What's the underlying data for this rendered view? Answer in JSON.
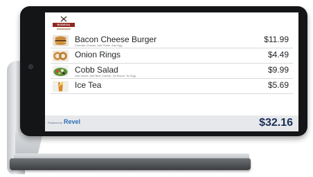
{
  "restaurant": {
    "logo_band_text": "BODEGA",
    "logo_icon": "fork-knife-icon"
  },
  "order": {
    "items": [
      {
        "name": "Bacon Cheese Burger",
        "modifiers": "Cheddar Cheese, Add Pickle, Add Egg",
        "price": "$11.99",
        "thumbnail_icon": "burger-icon"
      },
      {
        "name": "Onion Rings",
        "modifiers": "",
        "price": "$4.49",
        "thumbnail_icon": "onion-rings-icon"
      },
      {
        "name": "Cobb Salad",
        "modifiers": "Add Olives, Add Blue Cheese, No Bacon, No Egg",
        "price": "$9.99",
        "thumbnail_icon": "salad-icon"
      },
      {
        "name": "Ice Tea",
        "modifiers": "",
        "price": "$5.69",
        "thumbnail_icon": "ice-tea-icon"
      }
    ],
    "total": "$32.16"
  },
  "footer": {
    "powered_by": "Powered by",
    "brand": "Revel"
  },
  "colors": {
    "total_text": "#1a2e55",
    "brand_blue": "#2e6db4",
    "logo_red": "#8e2720",
    "footer_bg": "#e6e8eb"
  }
}
